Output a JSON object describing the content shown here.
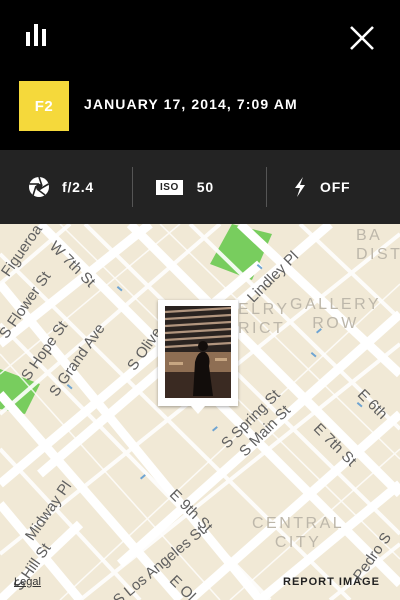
{
  "header": {
    "stats_icon": "bar-chart-icon",
    "close_icon": "close-icon",
    "filter_badge": "F2",
    "filter_color": "#f5d93b",
    "datetime": "JANUARY 17, 2014, 7:09 AM"
  },
  "exif": {
    "aperture_icon": "aperture-icon",
    "aperture": "f/2.4",
    "iso_label": "ISO",
    "iso": "50",
    "flash_icon": "flash-icon",
    "flash": "OFF"
  },
  "map": {
    "streets": [
      "W 7th St",
      "Figueroa",
      "S Flower St",
      "S Hope St",
      "S Grand Ave",
      "S Olive",
      "Lindley Pl",
      "S Spring St",
      "S Main St",
      "E 7th St",
      "E 6th",
      "E 9th St",
      "Midway Pl",
      "S Hill St",
      "S Los Angeles St",
      "E Ol",
      "Pedro S"
    ],
    "districts": {
      "jewelry_line1": "ELRY",
      "jewelry_line2": "RICT",
      "gallery_row_line1": "GALLERY",
      "gallery_row_line2": "ROW",
      "central_city_line1": "CENTRAL",
      "central_city_line2": "CITY",
      "bad_line1": "BA",
      "bad_line2": "DIST"
    },
    "legal": "Legal",
    "report": "REPORT IMAGE",
    "park_color": "#78cd5e"
  }
}
